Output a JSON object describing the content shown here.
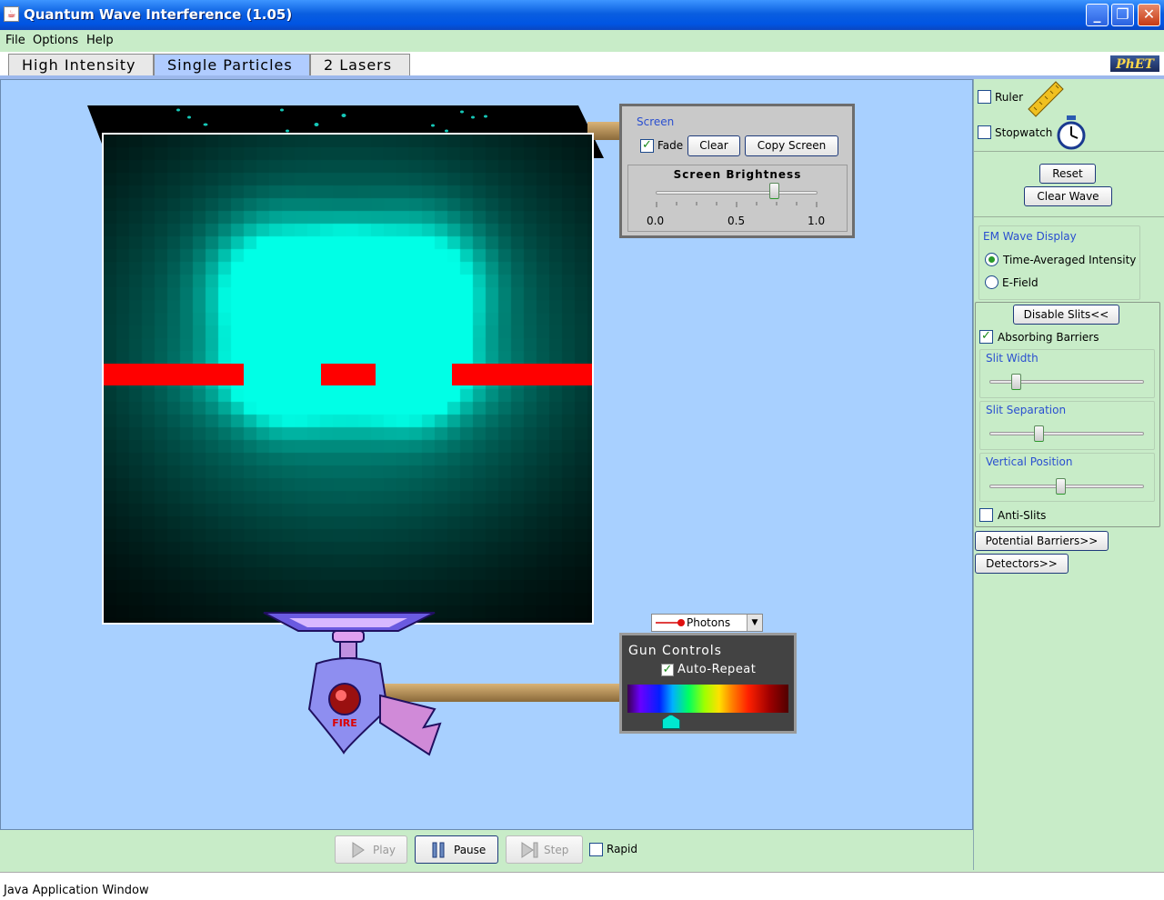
{
  "window": {
    "title": "Quantum Wave Interference (1.05)"
  },
  "menu": {
    "items": [
      "File",
      "Options",
      "Help"
    ]
  },
  "tabs": [
    "High Intensity",
    "Single Particles",
    "2 Lasers"
  ],
  "active_tab": "Single Particles",
  "logo": "PhET",
  "screen_panel": {
    "title": "Screen",
    "fade_label": "Fade",
    "fade_checked": true,
    "clear_label": "Clear",
    "copy_label": "Copy Screen",
    "brightness_title": "Screen Brightness",
    "brightness_value": 0.75,
    "ticks": [
      "0.0",
      "0.5",
      "1.0"
    ]
  },
  "gun": {
    "particle_type": "Photons",
    "panel_title": "Gun Controls",
    "auto_repeat_label": "Auto-Repeat",
    "auto_repeat_checked": true,
    "fire_label": "FIRE",
    "wavelength_fraction": 0.27
  },
  "controls": {
    "play_label": "Play",
    "pause_label": "Pause",
    "step_label": "Step",
    "rapid_label": "Rapid"
  },
  "status": {
    "text": "Java Application Window"
  },
  "sidebar": {
    "ruler_label": "Ruler",
    "stopwatch_label": "Stopwatch",
    "reset_label": "Reset",
    "clear_wave_label": "Clear Wave",
    "em_title": "EM Wave Display",
    "time_avg_label": "Time-Averaged Intensity",
    "efield_label": "E-Field",
    "display_mode": "Time-Averaged Intensity",
    "disable_slits_label": "Disable Slits<<",
    "absorbing_label": "Absorbing Barriers",
    "absorbing_checked": true,
    "slit_width_title": "Slit Width",
    "slit_width_value": 0.15,
    "slit_sep_title": "Slit Separation",
    "slit_sep_value": 0.31,
    "vert_pos_title": "Vertical Position",
    "vert_pos_value": 0.46,
    "anti_slits_label": "Anti-Slits",
    "potential_label": "Potential Barriers>>",
    "detectors_label": "Detectors>>"
  },
  "colors": {
    "wave": "#00ffe6",
    "barrier": "#ff0000",
    "play_area": "#a8d0ff",
    "panel_bg": "#c8ecc8"
  }
}
